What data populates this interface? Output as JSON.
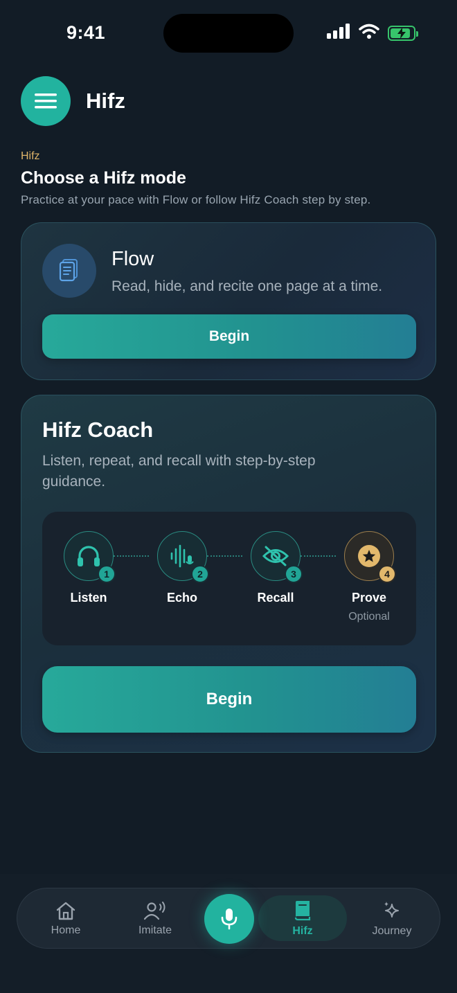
{
  "status_bar": {
    "time": "9:41"
  },
  "header": {
    "title": "Hifz"
  },
  "intro": {
    "eyebrow": "Hifz",
    "heading": "Choose a Hifz mode",
    "subtitle": "Practice at your pace with Flow or follow Hifz Coach step by step."
  },
  "flow_card": {
    "icon": "document-icon",
    "title": "Flow",
    "description": "Read, hide, and recite one page at a time.",
    "button_label": "Begin"
  },
  "coach_card": {
    "title": "Hifz Coach",
    "description": "Listen, repeat, and recall with step-by-step guidance.",
    "steps": [
      {
        "number": "1",
        "label": "Listen",
        "icon": "headphones-icon"
      },
      {
        "number": "2",
        "label": "Echo",
        "icon": "waveform-icon"
      },
      {
        "number": "3",
        "label": "Recall",
        "icon": "eye-off-icon"
      },
      {
        "number": "4",
        "label": "Prove",
        "sublabel": "Optional",
        "icon": "star-icon"
      }
    ],
    "button_label": "Begin"
  },
  "nav": {
    "items": [
      {
        "label": "Home",
        "icon": "home-icon"
      },
      {
        "label": "Imitate",
        "icon": "speaking-person-icon"
      },
      {
        "label": "Hifz",
        "icon": "book-icon",
        "active": true
      },
      {
        "label": "Journey",
        "icon": "sparkle-icon"
      }
    ],
    "mic_icon": "microphone-icon"
  },
  "colors": {
    "accent": "#22b39f",
    "gold": "#e2b86c",
    "background": "#121c26"
  }
}
